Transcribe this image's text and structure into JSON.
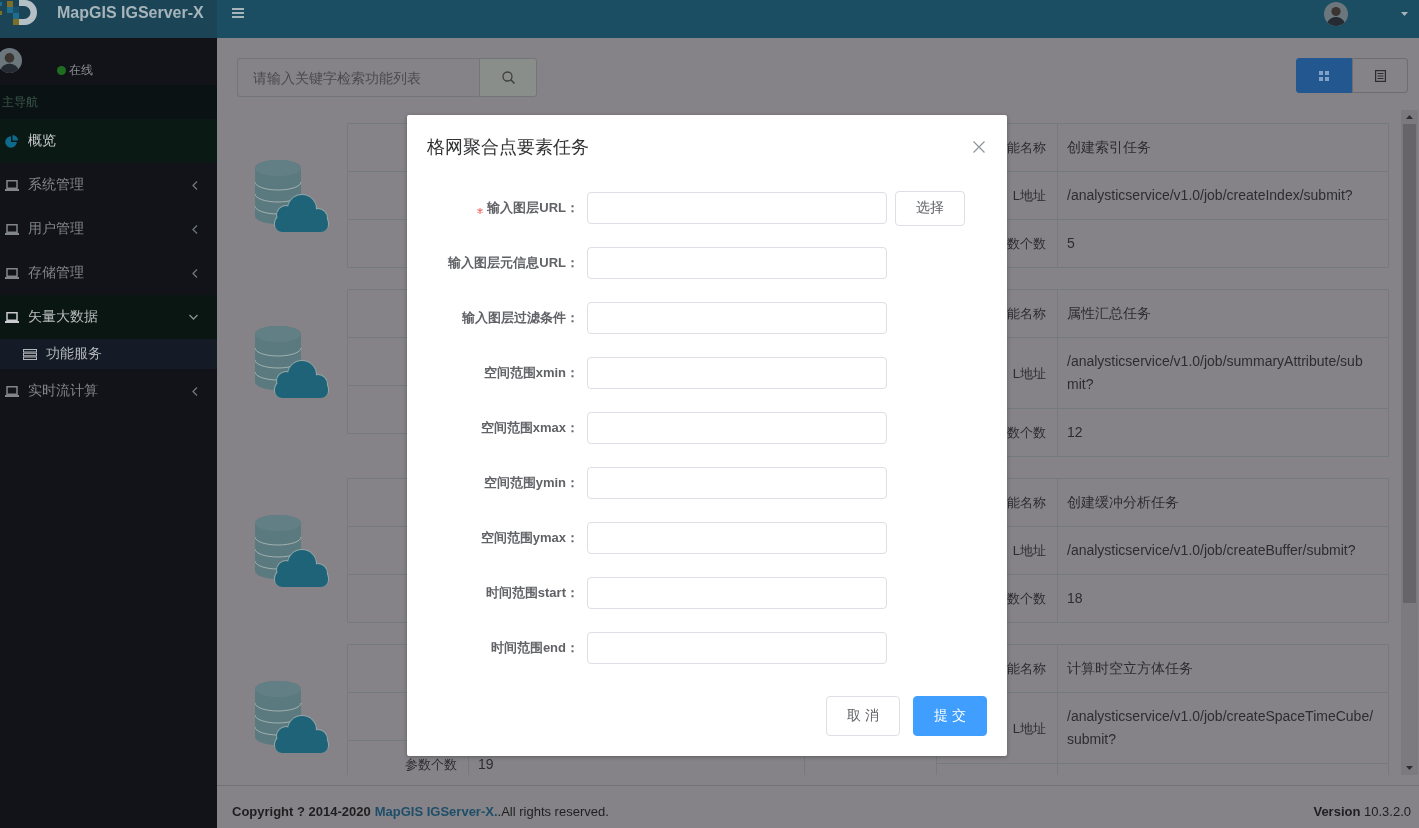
{
  "header": {
    "title": "MapGIS IGServer-X"
  },
  "sidebar": {
    "user": {
      "status": "在线",
      "online": true
    },
    "section_title": "主导航",
    "items": [
      {
        "kind": "link",
        "label": "概览",
        "selected": true
      },
      {
        "kind": "submenu",
        "label": "系统管理",
        "selected": false,
        "expanded": false
      },
      {
        "kind": "submenu",
        "label": "用户管理",
        "selected": false,
        "expanded": false
      },
      {
        "kind": "submenu",
        "label": "存储管理",
        "selected": false,
        "expanded": false
      },
      {
        "kind": "submenu",
        "label": "矢量大数据",
        "selected": false,
        "expanded": true,
        "children": [
          {
            "label": "功能服务",
            "selected": false
          }
        ]
      },
      {
        "kind": "submenu",
        "label": "实时流计算",
        "selected": false,
        "expanded": false
      }
    ]
  },
  "toolbar": {
    "search": {
      "placeholder": "请输入关键字检索功能列表"
    },
    "view_toggle": [
      {
        "kind": "grid",
        "selected": true
      },
      {
        "kind": "list",
        "selected": false
      }
    ]
  },
  "services": [
    {
      "right_rows": [
        {
          "label": "能名称",
          "value": "创建索引任务"
        },
        {
          "label": "L地址",
          "value": "/analysticservice/v1.0/job/createIndex/submit?"
        },
        {
          "label": "数个数",
          "value": "5"
        }
      ]
    },
    {
      "right_rows": [
        {
          "label": "能名称",
          "value": "属性汇总任务"
        },
        {
          "label": "L地址",
          "value": "/analysticservice/v1.0/job/summaryAttribute/submit?"
        },
        {
          "label": "数个数",
          "value": "12"
        }
      ]
    },
    {
      "right_rows": [
        {
          "label": "能名称",
          "value": "创建缓冲分析任务"
        },
        {
          "label": "L地址",
          "value": "/analysticservice/v1.0/job/createBuffer/submit?"
        },
        {
          "label": "数个数",
          "value": "18"
        }
      ]
    },
    {
      "left_rows": [
        null,
        null,
        {
          "label": "参数个数",
          "value": "19"
        }
      ],
      "right_rows": [
        {
          "label": "能名称",
          "value": "计算时空立方体任务"
        },
        {
          "label": "L地址",
          "value": "/analysticservice/v1.0/job/createSpaceTimeCube/submit?"
        }
      ]
    }
  ],
  "footer": {
    "copyright": "Copyright ? 2014-2020",
    "link": "MapGIS IGServer-X.",
    "rights": ".All rights reserved.",
    "version": "**Version** 10.3.2.0"
  },
  "modal": {
    "title": "格网聚合点要素任务",
    "fields": [
      {
        "label": "输入图层URL：",
        "required": true,
        "button": "选择"
      },
      {
        "label": "输入图层元信息URL：",
        "required": false
      },
      {
        "label": "输入图层过滤条件：",
        "required": false
      },
      {
        "label": "空间范围xmin：",
        "required": false
      },
      {
        "label": "空间范围xmax：",
        "required": false
      },
      {
        "label": "空间范围ymin：",
        "required": false
      },
      {
        "label": "空间范围ymax：",
        "required": false
      },
      {
        "label": "时间范围start：",
        "required": false
      },
      {
        "label": "时间范围end：",
        "required": false
      }
    ],
    "buttons": [
      {
        "label": "取消",
        "kind": "default"
      },
      {
        "label": "提交",
        "kind": "primary"
      }
    ]
  }
}
